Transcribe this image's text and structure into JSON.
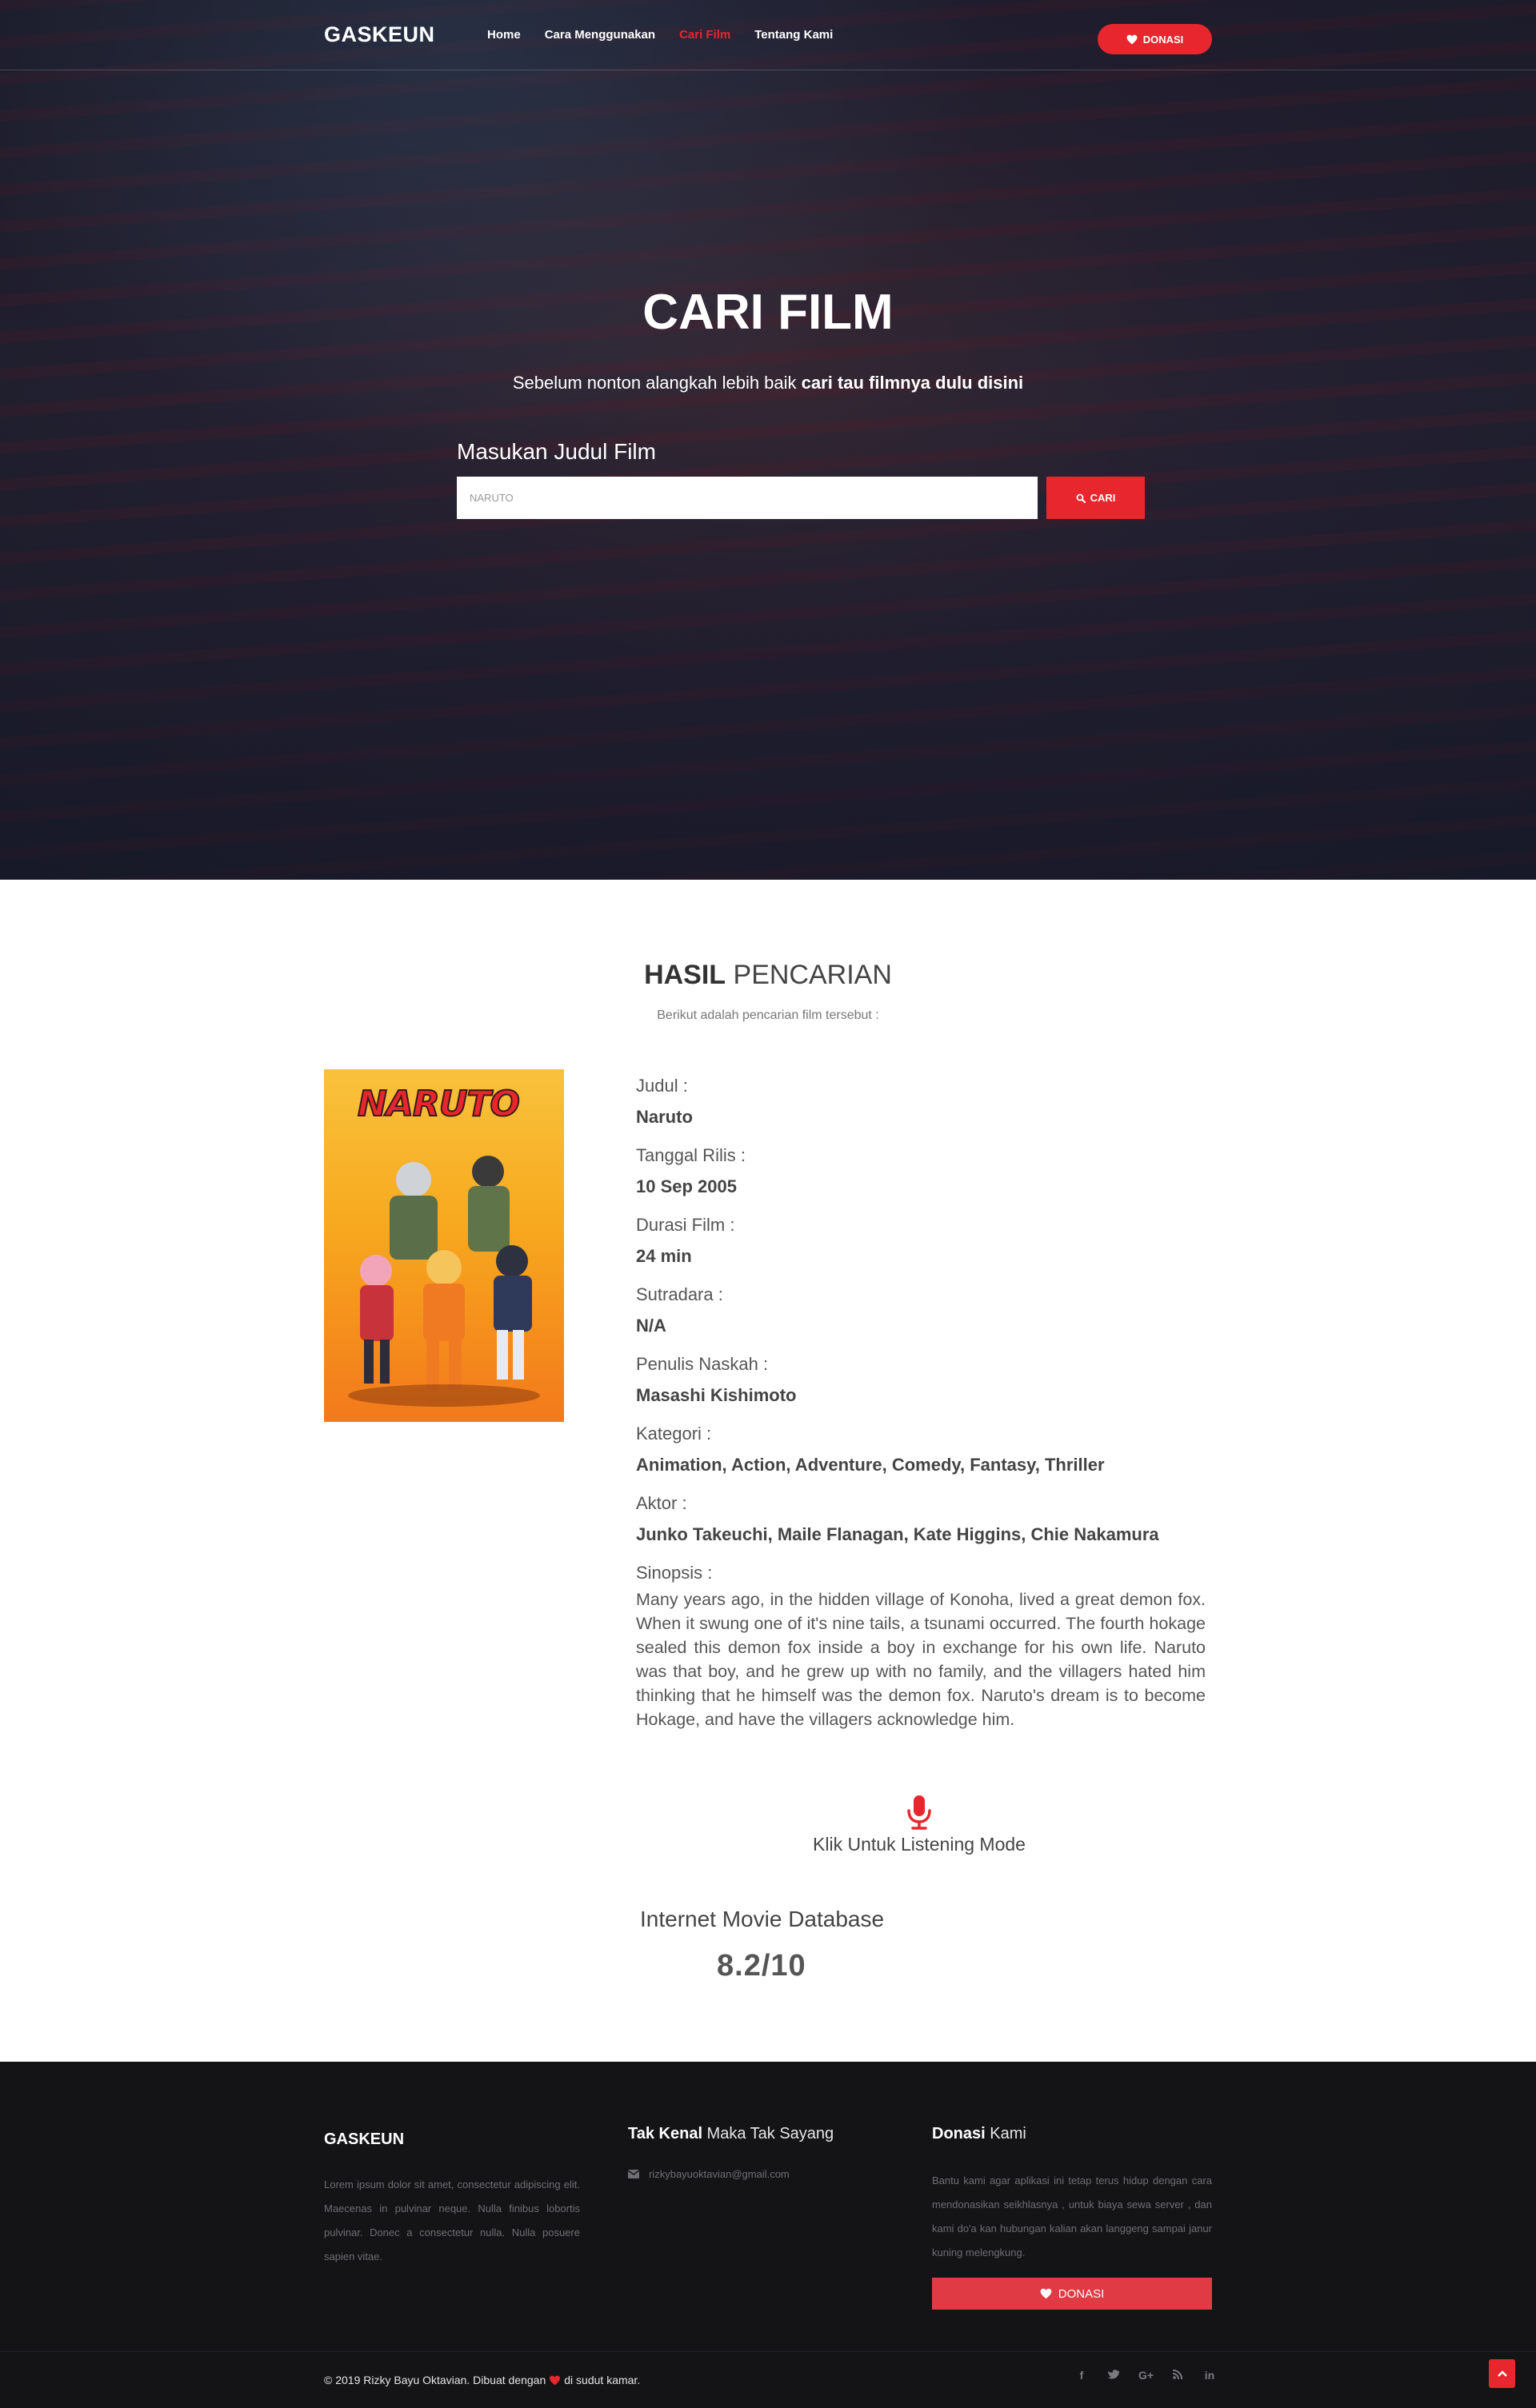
{
  "nav": {
    "brand": "GASKEUN",
    "links": [
      "Home",
      "Cara Menggunakan",
      "Cari Film",
      "Tentang Kami"
    ],
    "active_index": 2,
    "donate_label": "DONASI"
  },
  "hero": {
    "title": "CARI FILM",
    "subtitle_plain": "Sebelum nonton alangkah lebih baik ",
    "subtitle_bold": "cari tau filmnya dulu disini",
    "search_label": "Masukan Judul Film",
    "search_value": "NARUTO",
    "search_button": "CARI"
  },
  "results": {
    "title_bold": "HASIL",
    "title_rest": " PENCARIAN",
    "subtitle": "Berikut adalah pencarian film tersebut :",
    "poster_logo": "NARUTO",
    "fields": [
      {
        "label": "Judul :",
        "value": "Naruto"
      },
      {
        "label": "Tanggal Rilis :",
        "value": "10 Sep 2005"
      },
      {
        "label": "Durasi Film :",
        "value": "24 min"
      },
      {
        "label": "Sutradara :",
        "value": "N/A"
      },
      {
        "label": "Penulis Naskah :",
        "value": "Masashi Kishimoto"
      },
      {
        "label": "Kategori :",
        "value": "Animation, Action, Adventure, Comedy, Fantasy, Thriller"
      },
      {
        "label": "Aktor :",
        "value": "Junko Takeuchi, Maile Flanagan, Kate Higgins, Chie Nakamura"
      }
    ],
    "synopsis_label": "Sinopsis :",
    "synopsis": "Many years ago, in the hidden village of Konoha, lived a great demon fox. When it swung one of it's nine tails, a tsunami occurred. The fourth hokage sealed this demon fox inside a boy in exchange for his own life. Naruto was that boy, and he grew up with no family, and the villagers hated him thinking that he himself was the demon fox. Naruto's dream is to become Hokage, and have the villagers acknowledge him.",
    "listen_label": "Klik Untuk Listening Mode",
    "imdb_label": "Internet Movie Database",
    "imdb_score": "8.2/10"
  },
  "footer": {
    "col1_title": "GASKEUN",
    "col1_text": "Lorem ipsum dolor sit amet, consectetur adipiscing elit. Maecenas in pulvinar neque. Nulla finibus lobortis pulvinar. Donec a consectetur nulla. Nulla posuere sapien vitae.",
    "col2_title_bold": "Tak Kenal",
    "col2_title_rest": " Maka Tak Sayang",
    "email": "rizkybayuoktavian@gmail.com",
    "col3_title_bold": "Donasi",
    "col3_title_rest": " Kami",
    "col3_text": "Bantu kami agar aplikasi ini tetap terus hidup dengan cara mendonasikan seikhlasnya , untuk biaya sewa server , dan kami do'a kan hubungan kalian akan langgeng sampai janur kuning melengkung.",
    "donate_label": "DONASI",
    "copyright_a": "© 2019 Rizky Bayu Oktavian. Dibuat dengan",
    "copyright_b": "di sudut kamar.",
    "social": [
      "f",
      "t",
      "G+",
      "rss",
      "in"
    ]
  },
  "colors": {
    "accent": "#e8262d",
    "footer_bg": "#141416",
    "hero_bg": "#1d1e2b"
  }
}
